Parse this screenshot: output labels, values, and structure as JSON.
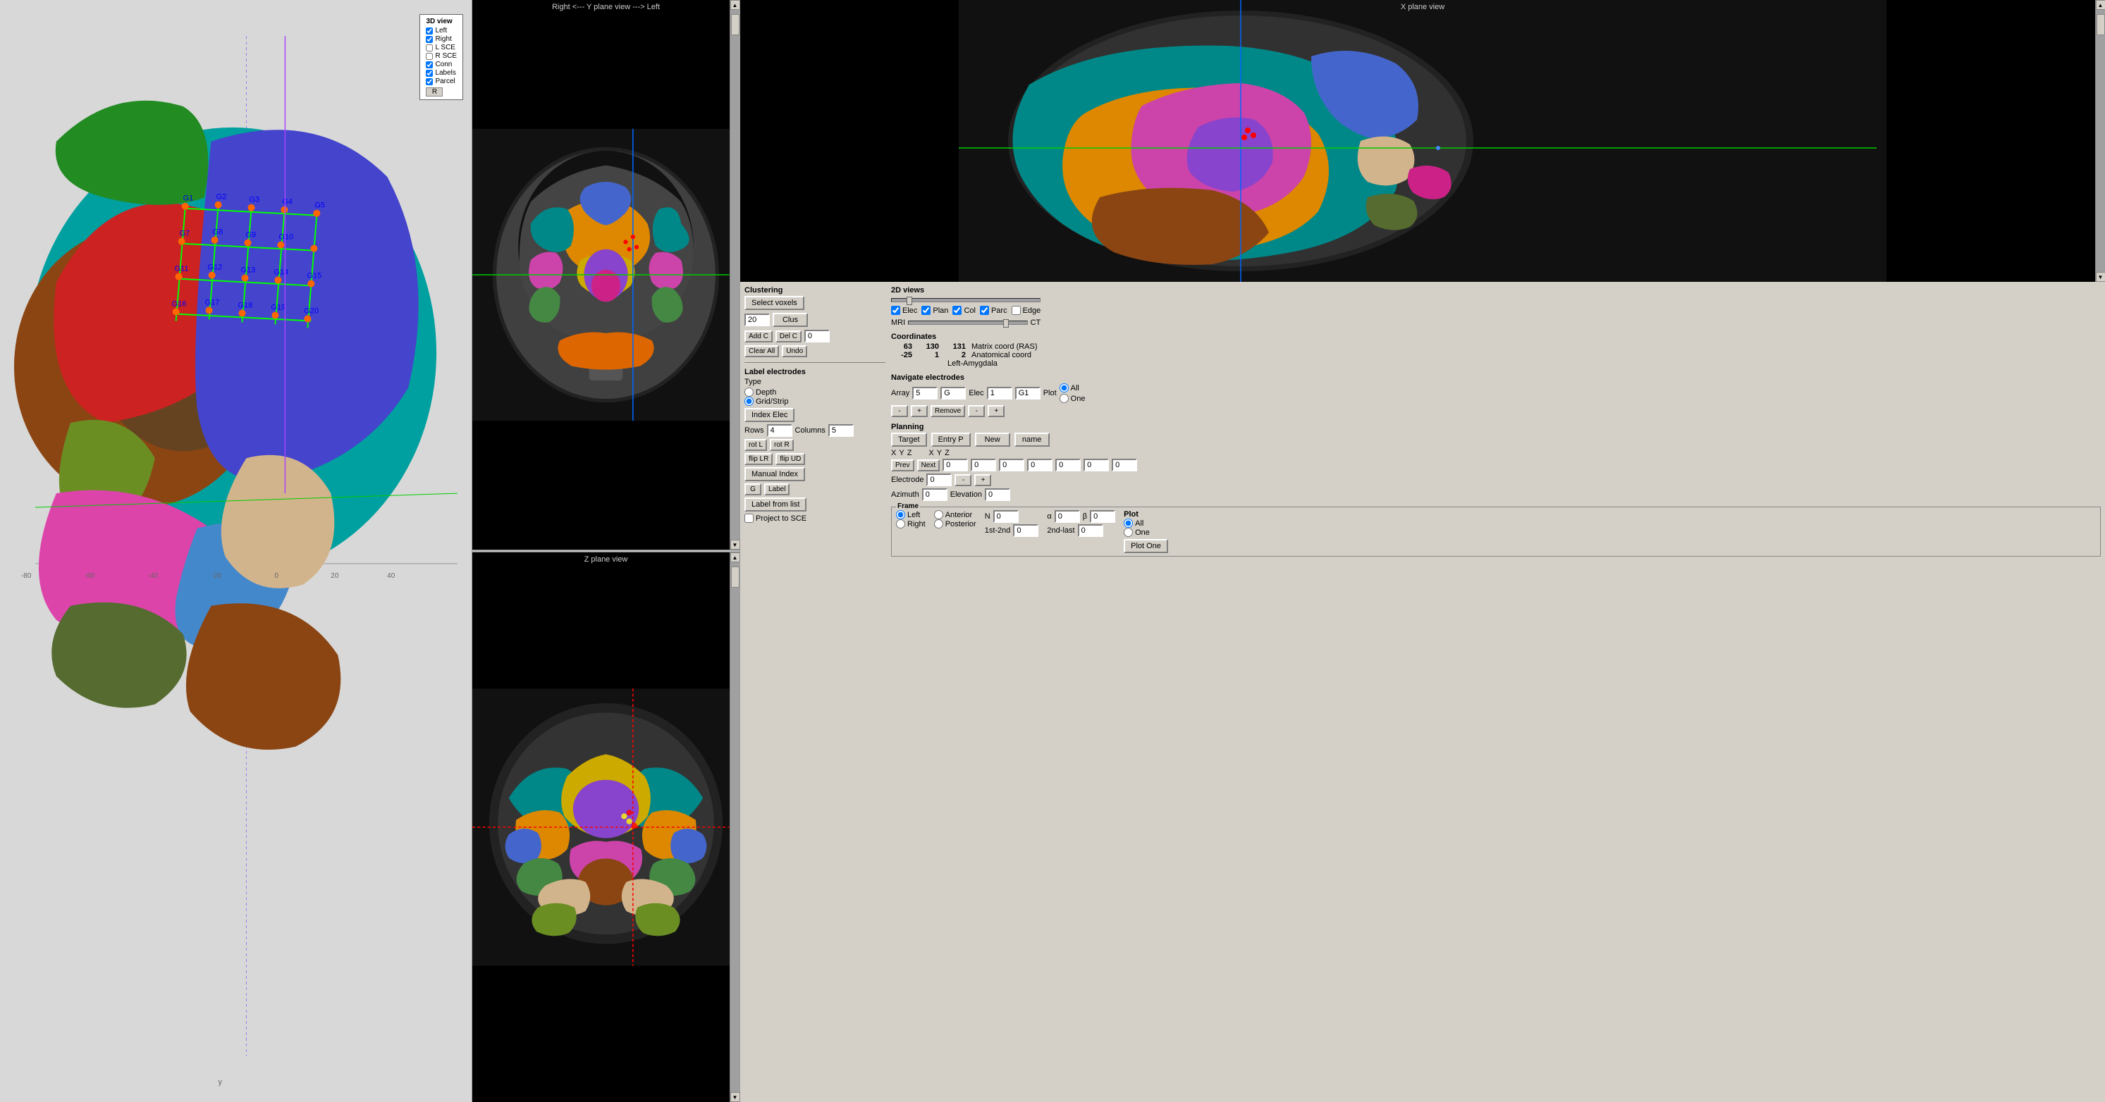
{
  "windows": {
    "view3d": {
      "title": "3D view",
      "legend": {
        "title": "3D view",
        "items": [
          {
            "label": "Left",
            "checked": true
          },
          {
            "label": "Right",
            "checked": true
          },
          {
            "label": "L SCE",
            "checked": false
          },
          {
            "label": "R SCE",
            "checked": false
          },
          {
            "label": "Conn",
            "checked": true
          },
          {
            "label": "Labels",
            "checked": true
          },
          {
            "label": "Parcel",
            "checked": true
          }
        ],
        "r_button": "R"
      },
      "axis": {
        "y_label": "y",
        "x_neg": "-80",
        "x_neg2": "-60",
        "x_neg3": "-40",
        "x_neg4": "-20",
        "x_zero": "0",
        "x_pos": "20",
        "x_pos2": "40"
      }
    },
    "y_plane": {
      "title": "Right <---   Y plane view   ---> Left"
    },
    "z_plane": {
      "title": "Z plane view"
    },
    "x_plane": {
      "title": "X plane view"
    }
  },
  "controls": {
    "clustering": {
      "header": "Clustering",
      "select_voxels_btn": "Select voxels",
      "clus_value": "20",
      "clus_btn": "Clus",
      "add_c_btn": "Add C",
      "del_c_btn": "Del C",
      "del_c_value": "0",
      "clear_all_btn": "Clear All",
      "undo_btn": "Undo"
    },
    "label_electrodes": {
      "header": "Label electrodes",
      "type_header": "Type",
      "depth_label": "Depth",
      "grid_strip_label": "Grid/Strip",
      "depth_checked": false,
      "grid_checked": true,
      "index_elec_btn": "Index Elec",
      "rows_label": "Rows",
      "rows_value": "4",
      "cols_label": "Columns",
      "cols_value": "5",
      "rot_l_btn": "rot L",
      "rot_r_btn": "rot R",
      "flip_lr_btn": "flip LR",
      "flip_ud_btn": "flip UD",
      "manual_index_btn": "Manual Index",
      "g_btn": "G",
      "label_btn": "Label",
      "label_from_list_btn": "Label from list",
      "project_to_sce_label": "Project to SCE",
      "project_checked": false
    },
    "views_2d": {
      "header": "2D views",
      "elec_label": "Elec",
      "elec_checked": true,
      "plan_label": "Plan",
      "plan_checked": true,
      "col_label": "Col",
      "col_checked": true,
      "parc_label": "Parc",
      "parc_checked": true,
      "edge_label": "Edge",
      "edge_checked": false,
      "mri_label": "MRI",
      "ct_label": "CT"
    },
    "coordinates": {
      "header": "Coordinates",
      "x": "63",
      "y": "130",
      "z": "131",
      "matrix_label": "Matrix coord (RAS)",
      "x2": "-25",
      "y2": "1",
      "z2": "2",
      "anatomical_label": "Anatomical coord",
      "region_label": "Left-Amygdala"
    },
    "navigate": {
      "header": "Navigate electrodes",
      "array_label": "Array",
      "array_value": "5",
      "g_value": "G",
      "elec_label": "Elec",
      "elec_value": "1",
      "g1_value": "G1",
      "plot_label": "Plot",
      "all_label": "All",
      "one_label": "One",
      "all_checked": true,
      "minus_btn": "-",
      "plus_btn": "+",
      "remove_btn": "Remove",
      "minus2_btn": "-",
      "plus2_btn": "+"
    },
    "planning": {
      "header": "Planning",
      "target_btn": "Target",
      "entry_p_btn": "Entry P",
      "new_btn": "New",
      "name_btn": "name",
      "x_label": "X",
      "y_label": "Y",
      "z_label": "Z",
      "x2_label": "X",
      "y2_label": "Y",
      "z2_label": "Z",
      "prev_btn": "Prev",
      "next_btn": "Next",
      "next_value": "0",
      "x_val": "0",
      "y_val": "0",
      "z_val": "0",
      "x2_val": "0",
      "y2_val": "0",
      "z2_val": "0",
      "electrode_label": "Electrode",
      "electrode_value": "0",
      "minus_btn": "-",
      "plus_btn": "+",
      "azimuth_label": "Azimuth",
      "azimuth_value": "0",
      "elevation_label": "Elevation",
      "elevation_value": "0"
    },
    "frame": {
      "header": "Frame",
      "left_label": "Left",
      "right_label": "Right",
      "anterior_label": "Anterior",
      "posterior_label": "Posterior",
      "left_checked": true,
      "right_checked": false,
      "anterior_checked": false,
      "posterior_checked": false,
      "n_label": "N",
      "n_value": "0",
      "first_second_label": "1st-2nd",
      "first_second_value": "0",
      "alpha_label": "α",
      "alpha_value": "0",
      "beta_label": "β",
      "beta_value": "0",
      "second_last_label": "2nd-last",
      "second_last_value": "0",
      "plot_label": "Plot",
      "all_label": "All",
      "one_label": "One",
      "plot_one_btn": "Plot One",
      "all_radio_checked": true,
      "one_radio_checked": false
    }
  }
}
